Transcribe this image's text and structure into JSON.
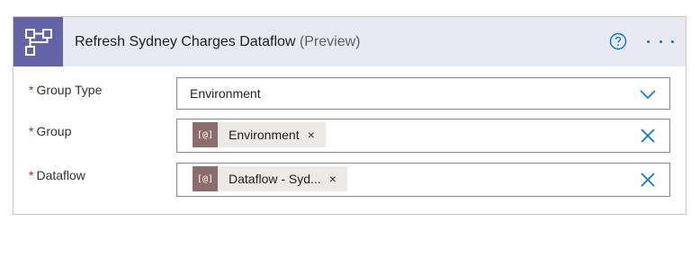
{
  "header": {
    "icon": "dataflow-icon",
    "title": "Refresh Sydney Charges Dataflow",
    "subtitle": "(Preview)",
    "help_icon": "help-icon",
    "more_icon": "more-options-icon",
    "accent_color": "#6264a7",
    "link_color": "#0078d4"
  },
  "fields": {
    "group_type": {
      "required_mark": "*",
      "label": "Group Type",
      "value": "Environment",
      "control_icon": "chevron-down-icon"
    },
    "group": {
      "required_mark": "*",
      "label": "Group",
      "token_icon": "[@]",
      "token_label": "Environment",
      "token_remove": "×",
      "control_icon": "clear-icon"
    },
    "dataflow": {
      "required_mark": "*",
      "label": "Dataflow",
      "token_icon": "[@]",
      "token_label": "Dataflow - Syd...",
      "token_remove": "×",
      "control_icon": "clear-icon"
    }
  }
}
